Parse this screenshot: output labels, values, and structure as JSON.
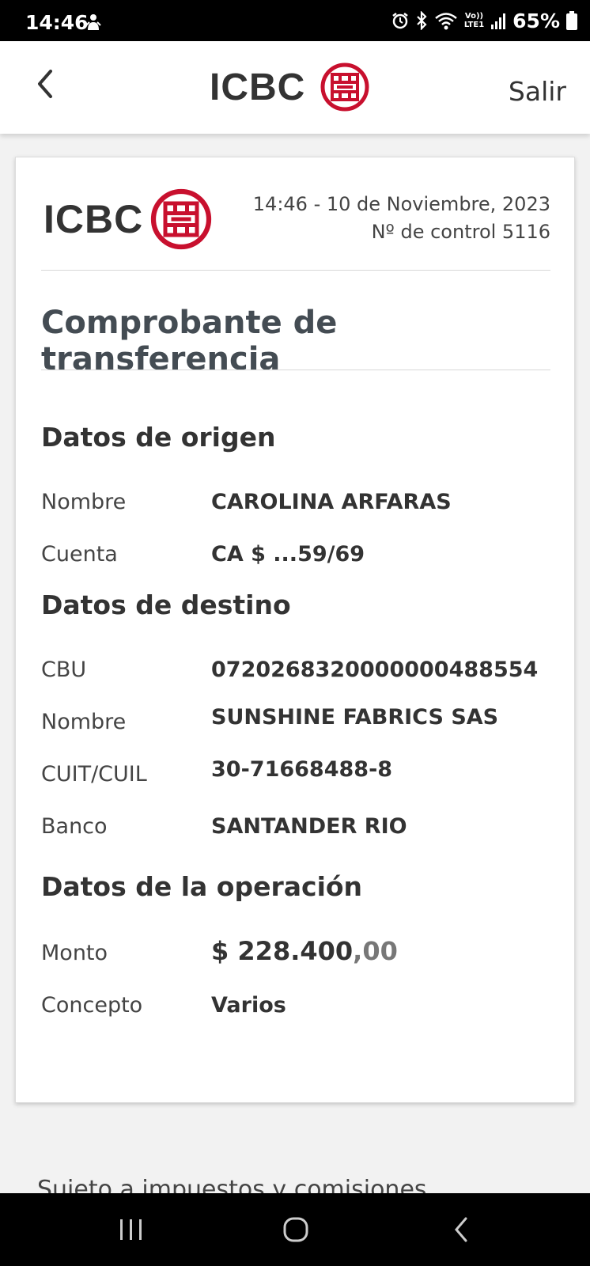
{
  "status_bar": {
    "time": "14:46",
    "battery": "65%",
    "icons": [
      "person-icon",
      "alarm-icon",
      "bluetooth-icon",
      "wifi-icon",
      "volte-icon",
      "signal-icon",
      "battery-icon"
    ],
    "volte_label_top": "Vo))",
    "volte_label_bottom": "LTE1"
  },
  "header": {
    "logo_text": "ICBC",
    "logout_label": "Salir",
    "back_icon": "chevron-left-icon"
  },
  "receipt": {
    "logo_text": "ICBC",
    "datetime": "14:46 - 10 de Noviembre, 2023",
    "control": "Nº de control 5116",
    "title": "Comprobante de transferencia",
    "origin": {
      "title": "Datos de origen",
      "name_label": "Nombre",
      "name_value": "CAROLINA ARFARAS",
      "account_label": "Cuenta",
      "account_value": "CA $ ...59/69"
    },
    "destination": {
      "title": "Datos de destino",
      "cbu_label": "CBU",
      "cbu_value": "0720268320000000488554",
      "name_label": "Nombre",
      "name_value": "SUNSHINE FABRICS SAS",
      "cuit_label": "CUIT/CUIL",
      "cuit_value": "30-71668488-8",
      "bank_label": "Banco",
      "bank_value": "SANTANDER RIO"
    },
    "operation": {
      "title": "Datos de la operación",
      "amount_label": "Monto",
      "amount_integer": "$ 228.400",
      "amount_decimals": ",00",
      "concept_label": "Concepto",
      "concept_value": "Varios"
    }
  },
  "footer_note": "Sujeto a impuestos y comisiones",
  "colors": {
    "brand_red": "#c8102e",
    "text_dark": "#333333",
    "title_gray": "#444c53"
  },
  "nav_bar": {
    "icons": [
      "recent-apps-icon",
      "home-icon",
      "back-icon"
    ]
  }
}
